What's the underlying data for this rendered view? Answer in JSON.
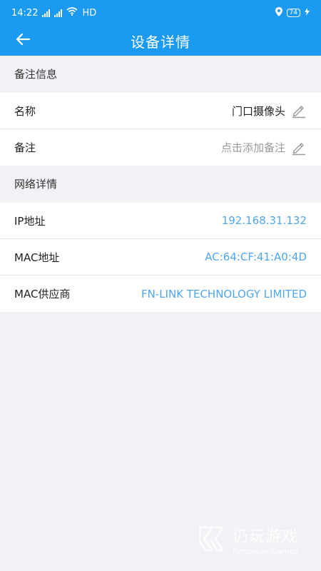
{
  "status_bar": {
    "time": "14:22",
    "network": "HD",
    "battery": "74"
  },
  "app_bar": {
    "title": "设备详情"
  },
  "note_section": {
    "header": "备注信息",
    "rows": [
      {
        "label": "名称",
        "value": "门口摄像头",
        "value_style": "dark",
        "editable": true
      },
      {
        "label": "备注",
        "value": "点击添加备注",
        "value_style": "placeholder",
        "editable": true
      }
    ]
  },
  "network_section": {
    "header": "网络详情",
    "rows": [
      {
        "label": "IP地址",
        "value": "192.168.31.132"
      },
      {
        "label": "MAC地址",
        "value": "AC:64:CF:41:A0:4D"
      },
      {
        "label": "MAC供应商",
        "value": "FN-LINK TECHNOLOGY LIMITED"
      }
    ]
  },
  "watermark": {
    "cn": "仍玩游戏",
    "en": "Rengwan Games"
  },
  "colors": {
    "primary": "#1a9af0",
    "value_blue": "#4fa6ef",
    "background": "#f2f2f6"
  },
  "icons": {
    "back": "arrow-left-icon",
    "edit": "pencil-icon"
  }
}
